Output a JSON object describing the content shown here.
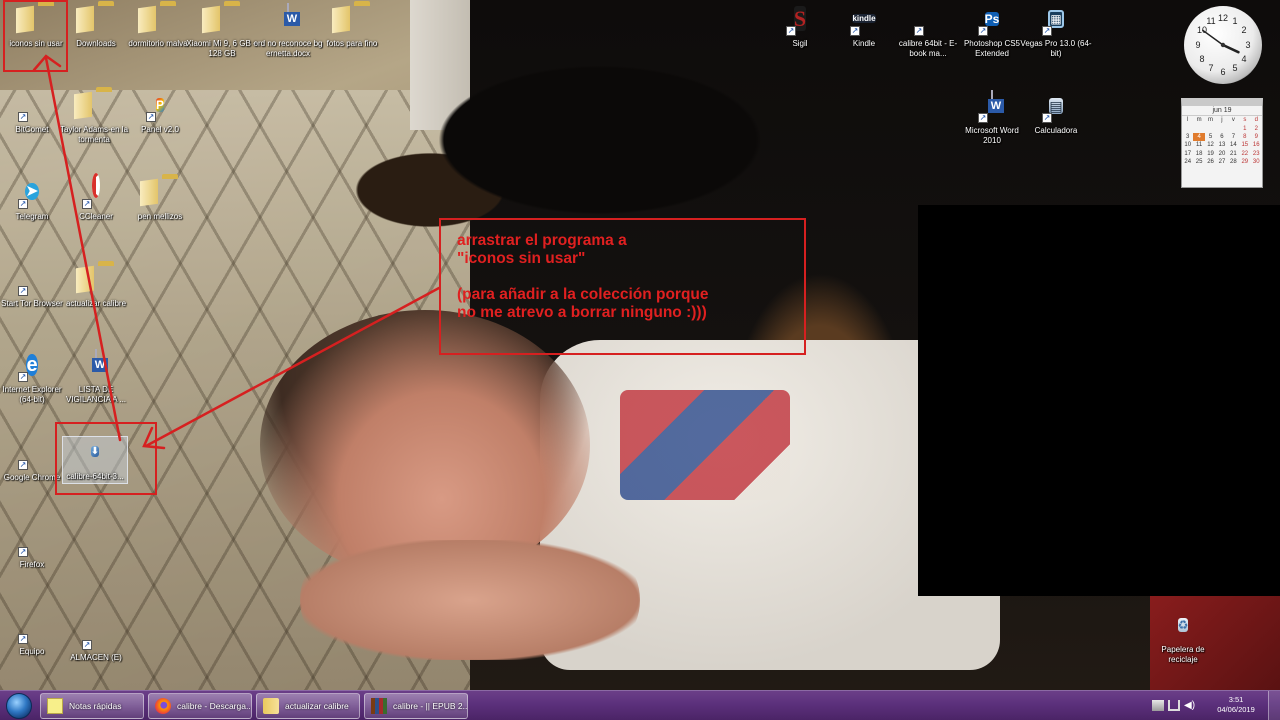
{
  "desktop": {
    "icons": [
      {
        "id": "iconos-sin-usar",
        "label": "iconos sin usar"
      },
      {
        "id": "downloads",
        "label": "Downloads"
      },
      {
        "id": "dormitorio-malva",
        "label": "dormitorio malva"
      },
      {
        "id": "xiaomi",
        "label": "Xiaomi Mi 9, 6 GB + 128 GB"
      },
      {
        "id": "word-doc",
        "label": "ord no reconoce bg ernetta.docx"
      },
      {
        "id": "fotos-para-fino",
        "label": "fotos para fino"
      },
      {
        "id": "bitcomet",
        "label": "BitComet"
      },
      {
        "id": "taylor-adams",
        "label": "Taylor Adams-en la tormenta"
      },
      {
        "id": "panel",
        "label": "Panel v2.0"
      },
      {
        "id": "telegram",
        "label": "Telegram"
      },
      {
        "id": "ccleaner",
        "label": "CCleaner"
      },
      {
        "id": "pen-mellizos",
        "label": "pen mellizos"
      },
      {
        "id": "tor-browser",
        "label": "Start Tor Browser"
      },
      {
        "id": "actualizar-calibre",
        "label": "actualizar calibre"
      },
      {
        "id": "internet-explorer",
        "label": "Internet Explorer (64-bit)"
      },
      {
        "id": "lista-vigilancia",
        "label": "LISTA DE VIGILANCIA A ..."
      },
      {
        "id": "google-chrome",
        "label": "Google Chrome"
      },
      {
        "id": "calibre-installer",
        "label": "calibre-64bit-3..."
      },
      {
        "id": "firefox",
        "label": "Firefox"
      },
      {
        "id": "equipo",
        "label": "Equipo"
      },
      {
        "id": "almacen",
        "label": "ALMACEN (E)"
      },
      {
        "id": "sigil",
        "label": "Sigil"
      },
      {
        "id": "kindle",
        "label": "Kindle"
      },
      {
        "id": "calibre-64",
        "label": "calibre 64bit - E-book ma..."
      },
      {
        "id": "photoshop",
        "label": "Photoshop CS5 Extended"
      },
      {
        "id": "vegas",
        "label": "Vegas Pro 13.0 (64-bit)"
      },
      {
        "id": "word-2010",
        "label": "Microsoft Word 2010"
      },
      {
        "id": "calculadora",
        "label": "Calculadora"
      },
      {
        "id": "papelera",
        "label": "Papelera de reciclaje"
      }
    ]
  },
  "annotation": {
    "lines": [
      "arrastrar el programa a",
      "\"iconos sin usar\"",
      "(para añadir a la colección porque",
      "no me atrevo a borrar ninguno :)))"
    ],
    "color": "#d62020"
  },
  "calendar": {
    "month": "jun 19",
    "weekdays": [
      "l",
      "m",
      "m",
      "j",
      "v",
      "s",
      "d"
    ],
    "weeks": [
      [
        "",
        "",
        "",
        "",
        "",
        "1",
        "2"
      ],
      [
        "3",
        "4",
        "5",
        "6",
        "7",
        "8",
        "9"
      ],
      [
        "10",
        "11",
        "12",
        "13",
        "14",
        "15",
        "16"
      ],
      [
        "17",
        "18",
        "19",
        "20",
        "21",
        "22",
        "23"
      ],
      [
        "24",
        "25",
        "26",
        "27",
        "28",
        "29",
        "30"
      ]
    ],
    "today": "4"
  },
  "clock": {
    "hour_deg": 115,
    "minute_deg": 306
  },
  "taskbar": {
    "buttons": [
      {
        "label": "Notas rápidas",
        "icon": "sticky-notes-icon"
      },
      {
        "label": "calibre - Descarga...",
        "icon": "firefox-icon"
      },
      {
        "label": "actualizar calibre",
        "icon": "folder-icon"
      },
      {
        "label": "calibre - || EPUB 2...",
        "icon": "calibre-icon"
      }
    ],
    "time": "3:51",
    "date": "04/06/2019"
  }
}
